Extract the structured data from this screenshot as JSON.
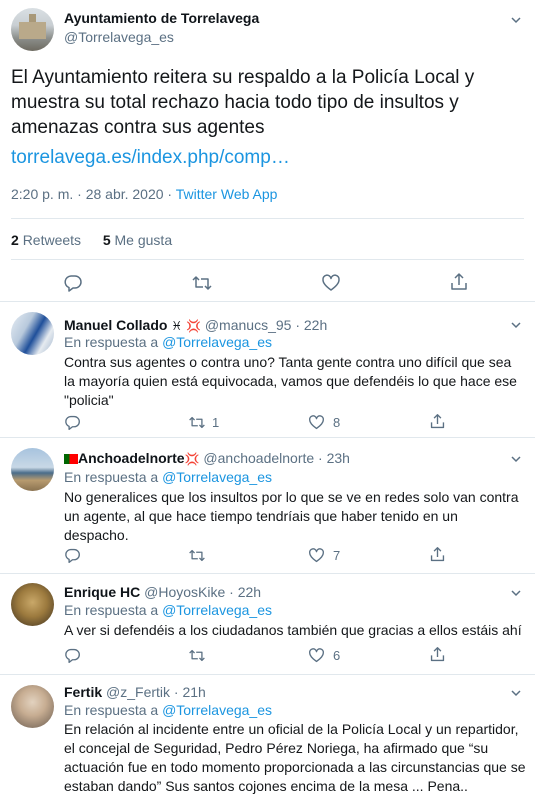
{
  "main": {
    "name": "Ayuntamiento de Torrelavega",
    "handle": "@Torrelavega_es",
    "text": "El Ayuntamiento reitera su respaldo a la Policía Local y muestra su total rechazo hacia todo tipo de insultos y amenazas contra sus agentes",
    "link": "torrelavega.es/index.php/comp…",
    "time": "2:20 p. m. · 28 abr. 2020 · ",
    "source": "Twitter Web App",
    "retweets_count": "2",
    "retweets_label": "Retweets",
    "likes_count": "5",
    "likes_label": "Me gusta"
  },
  "reply_prefix": "En respuesta a ",
  "replies": [
    {
      "name": "Manuel Collado",
      "name_suffix": "♓︎",
      "handle": "@manucs_95 · 22h",
      "reply_to": "@Torrelavega_es",
      "text": "Contra sus agentes o contra uno? Tanta gente contra uno difícil que sea la mayoría quien está equivocada, vamos que defendéis lo que hace ese \"policia\"",
      "retweets": "1",
      "likes": "8"
    },
    {
      "name": "Anchoadelnorte",
      "name_suffix": "",
      "handle": "@anchoadelnorte · 23h",
      "reply_to": "@Torrelavega_es",
      "text": "No generalices que los insultos por lo que se ve en redes solo van contra un agente, al que hace tiempo tendríais que haber tenido en un despacho.",
      "retweets": "",
      "likes": "7"
    },
    {
      "name": "Enrique HC",
      "name_suffix": "",
      "handle": "@HoyosKike · 22h",
      "reply_to": "@Torrelavega_es",
      "text": "A ver si defendéis a los ciudadanos también que gracias a ellos estáis ahí",
      "retweets": "",
      "likes": "6"
    },
    {
      "name": "Fertik",
      "name_suffix": "",
      "handle": "@z_Fertik · 21h",
      "reply_to": "@Torrelavega_es",
      "text": "En relación al incidente entre un oficial de la Policía Local y un repartidor, el concejal de Seguridad, Pedro Pérez Noriega, ha afirmado que “su actuación fue en todo momento proporcionada a las circunstancias que se estaban dando” Sus santos cojones encima de la mesa ... Pena..",
      "retweets": "",
      "likes": ""
    }
  ],
  "colors": {
    "link": "#1b95e0",
    "secondary": "#5b7083",
    "border": "#e1e8ed"
  },
  "icons": [
    "chevron-down-icon",
    "reply-icon",
    "retweet-icon",
    "like-icon",
    "share-icon",
    "anger-emoji-icon",
    "portugal-flag-icon"
  ]
}
